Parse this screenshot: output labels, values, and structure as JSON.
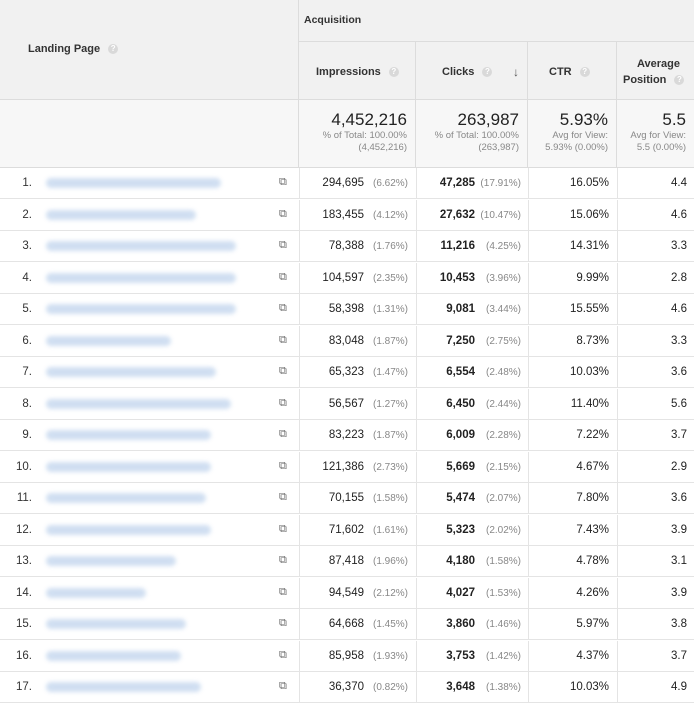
{
  "header": {
    "landing_page": "Landing Page",
    "acquisition": "Acquisition",
    "impressions": "Impressions",
    "clicks": "Clicks",
    "ctr": "CTR",
    "avg_position_l1": "Average",
    "avg_position_l2": "Position",
    "sort_icon": "sort-down-arrow",
    "help_icon": "?"
  },
  "totals": {
    "impressions": "4,452,216",
    "impressions_sub1": "% of Total: 100.00%",
    "impressions_sub2": "(4,452,216)",
    "clicks": "263,987",
    "clicks_sub1": "% of Total: 100.00%",
    "clicks_sub2": "(263,987)",
    "ctr": "5.93%",
    "ctr_sub1": "Avg for View:",
    "ctr_sub2": "5.93% (0.00%)",
    "pos": "5.5",
    "pos_sub1": "Avg for View:",
    "pos_sub2": "5.5 (0.00%)"
  },
  "rows": [
    {
      "idx": "1.",
      "imp": "294,695",
      "imp_pct": "(6.62%)",
      "clk": "47,285",
      "clk_pct": "(17.91%)",
      "ctr": "16.05%",
      "pos": "4.4"
    },
    {
      "idx": "2.",
      "imp": "183,455",
      "imp_pct": "(4.12%)",
      "clk": "27,632",
      "clk_pct": "(10.47%)",
      "ctr": "15.06%",
      "pos": "4.6"
    },
    {
      "idx": "3.",
      "imp": "78,388",
      "imp_pct": "(1.76%)",
      "clk": "11,216",
      "clk_pct": "(4.25%)",
      "ctr": "14.31%",
      "pos": "3.3"
    },
    {
      "idx": "4.",
      "imp": "104,597",
      "imp_pct": "(2.35%)",
      "clk": "10,453",
      "clk_pct": "(3.96%)",
      "ctr": "9.99%",
      "pos": "2.8"
    },
    {
      "idx": "5.",
      "imp": "58,398",
      "imp_pct": "(1.31%)",
      "clk": "9,081",
      "clk_pct": "(3.44%)",
      "ctr": "15.55%",
      "pos": "4.6"
    },
    {
      "idx": "6.",
      "imp": "83,048",
      "imp_pct": "(1.87%)",
      "clk": "7,250",
      "clk_pct": "(2.75%)",
      "ctr": "8.73%",
      "pos": "3.3"
    },
    {
      "idx": "7.",
      "imp": "65,323",
      "imp_pct": "(1.47%)",
      "clk": "6,554",
      "clk_pct": "(2.48%)",
      "ctr": "10.03%",
      "pos": "3.6"
    },
    {
      "idx": "8.",
      "imp": "56,567",
      "imp_pct": "(1.27%)",
      "clk": "6,450",
      "clk_pct": "(2.44%)",
      "ctr": "11.40%",
      "pos": "5.6"
    },
    {
      "idx": "9.",
      "imp": "83,223",
      "imp_pct": "(1.87%)",
      "clk": "6,009",
      "clk_pct": "(2.28%)",
      "ctr": "7.22%",
      "pos": "3.7"
    },
    {
      "idx": "10.",
      "imp": "121,386",
      "imp_pct": "(2.73%)",
      "clk": "5,669",
      "clk_pct": "(2.15%)",
      "ctr": "4.67%",
      "pos": "2.9"
    },
    {
      "idx": "11.",
      "imp": "70,155",
      "imp_pct": "(1.58%)",
      "clk": "5,474",
      "clk_pct": "(2.07%)",
      "ctr": "7.80%",
      "pos": "3.6"
    },
    {
      "idx": "12.",
      "imp": "71,602",
      "imp_pct": "(1.61%)",
      "clk": "5,323",
      "clk_pct": "(2.02%)",
      "ctr": "7.43%",
      "pos": "3.9"
    },
    {
      "idx": "13.",
      "imp": "87,418",
      "imp_pct": "(1.96%)",
      "clk": "4,180",
      "clk_pct": "(1.58%)",
      "ctr": "4.78%",
      "pos": "3.1"
    },
    {
      "idx": "14.",
      "imp": "94,549",
      "imp_pct": "(2.12%)",
      "clk": "4,027",
      "clk_pct": "(1.53%)",
      "ctr": "4.26%",
      "pos": "3.9"
    },
    {
      "idx": "15.",
      "imp": "64,668",
      "imp_pct": "(1.45%)",
      "clk": "3,860",
      "clk_pct": "(1.46%)",
      "ctr": "5.97%",
      "pos": "3.8"
    },
    {
      "idx": "16.",
      "imp": "85,958",
      "imp_pct": "(1.93%)",
      "clk": "3,753",
      "clk_pct": "(1.42%)",
      "ctr": "4.37%",
      "pos": "3.7"
    },
    {
      "idx": "17.",
      "imp": "36,370",
      "imp_pct": "(0.82%)",
      "clk": "3,648",
      "clk_pct": "(1.38%)",
      "ctr": "10.03%",
      "pos": "4.9"
    }
  ]
}
